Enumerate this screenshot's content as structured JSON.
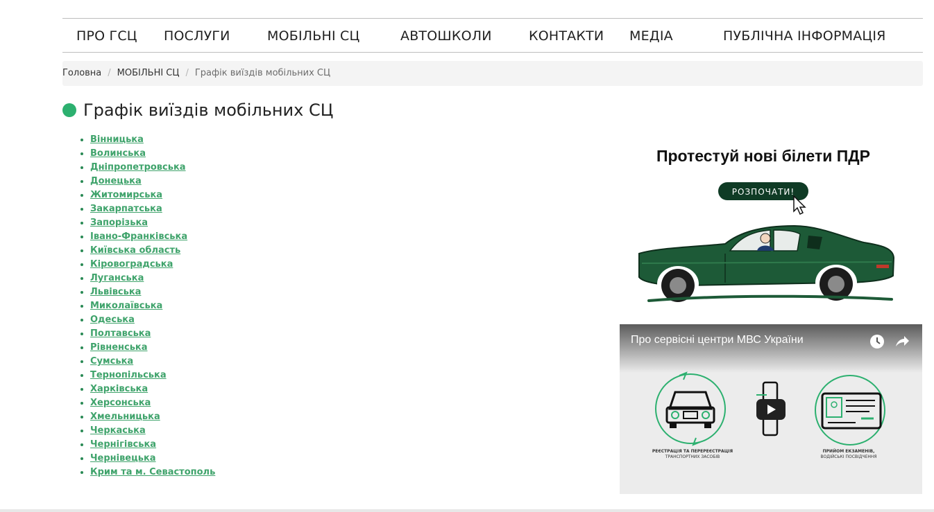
{
  "nav": {
    "items": [
      "ПРО ГСЦ",
      "ПОСЛУГИ",
      "МОБІЛЬНІ СЦ",
      "АВТОШКОЛИ",
      "КОНТАКТИ",
      "МЕДІА",
      "ПУБЛІЧНА ІНФОРМАЦІЯ"
    ]
  },
  "breadcrumb": {
    "home": "Головна",
    "section": "МОБІЛЬНІ СЦ",
    "current": "Графік виїздів мобільних СЦ",
    "separator": "/"
  },
  "page": {
    "title": "Графік виїздів мобільних СЦ",
    "accent_color": "#2cb06f",
    "link_color": "#3fa36b"
  },
  "regions": [
    "Вінницька",
    "Волинська",
    "Дніпропетровська",
    "Донецька",
    "Житомирська",
    "Закарпатська",
    "Запорізька",
    "Івано-Франківська",
    "Київська область",
    "Кіровоградська",
    "Луганська",
    "Львівська",
    "Миколаївська",
    "Одеська",
    "Полтавська",
    "Рівненська",
    "Сумська",
    "Тернопільська",
    "Харківська",
    "Херсонська",
    "Хмельницька",
    "Черкаська",
    "Чернігівська",
    "Чернівецька",
    "Крим та м. Севастополь"
  ],
  "promo": {
    "title": "Протестуй нові білети ПДР",
    "button": "РОЗПОЧАТИ!",
    "car_color": "#1d5a37"
  },
  "video": {
    "title": "Про сервісні центри МВС України",
    "caption_left_1": "РЕЄСТРАЦІЯ ТА ПЕРЕРЕЄСТРАЦІЯ",
    "caption_left_2": "ТРАНСПОРТНИХ ЗАСОБІВ",
    "caption_right_1": "ПРИЙОМ ЕКЗАМЕНІВ,",
    "caption_right_2": "ВОДІЙСЬКІ ПОСВІДЧЕННЯ"
  }
}
